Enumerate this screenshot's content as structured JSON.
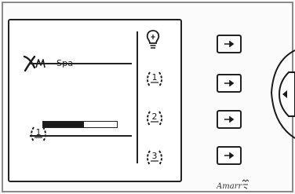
{
  "panel": {
    "brand_mark": "XM",
    "title": "Spa"
  },
  "main_zone": {
    "icon": "zone-1-icon",
    "level_fraction": 0.55
  },
  "right_column": {
    "icons": [
      "light-bulb-icon",
      "zone-1-icon",
      "zone-2-icon",
      "zone-3-icon"
    ]
  },
  "side_buttons": [
    {
      "icon": "arrow-right-icon"
    },
    {
      "icon": "arrow-right-icon"
    },
    {
      "icon": "arrow-right-icon"
    },
    {
      "icon": "arrow-right-icon"
    }
  ],
  "dpad": {
    "icon": "arrow-left-icon"
  },
  "footer": {
    "logo": "Amarr"
  },
  "colors": {
    "ink": "#1a1a1a",
    "background": "#ffffff"
  }
}
